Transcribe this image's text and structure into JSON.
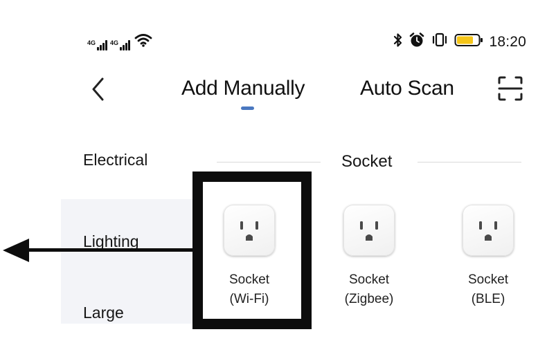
{
  "status_bar": {
    "signal_1_label": "4G",
    "signal_2_label": "4G",
    "time": "18:20",
    "icons": [
      "signal-icon",
      "signal-icon",
      "wifi-icon",
      "bluetooth-icon",
      "alarm-icon",
      "vibrate-icon",
      "battery-icon"
    ],
    "battery_color": "#f5c518"
  },
  "header": {
    "back_icon": "chevron-left-icon",
    "tabs": [
      {
        "label": "Add Manually",
        "active": true
      },
      {
        "label": "Auto Scan",
        "active": false
      }
    ],
    "scan_icon": "scan-frame-icon",
    "active_indicator_color": "#4a78c0"
  },
  "categories": [
    {
      "label": "Electrical",
      "selected": false
    },
    {
      "label": "Lighting",
      "selected": true
    },
    {
      "label": "Large",
      "selected": false
    }
  ],
  "section": {
    "title": "Socket"
  },
  "devices": [
    {
      "line1": "Socket",
      "line2": "(Wi-Fi)",
      "icon": "power-socket-icon",
      "highlighted": true
    },
    {
      "line1": "Socket",
      "line2": "(Zigbee)",
      "icon": "power-socket-icon",
      "highlighted": false
    },
    {
      "line1": "Socket",
      "line2": "(BLE)",
      "icon": "power-socket-icon",
      "highlighted": false
    }
  ],
  "annotations": {
    "highlight": "black rectangle around Socket (Wi-Fi)",
    "arrow": "left-pointing arrow"
  }
}
